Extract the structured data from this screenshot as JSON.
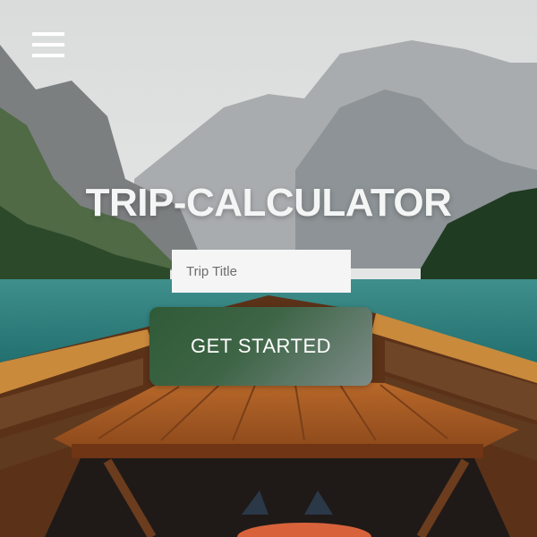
{
  "app": {
    "title": "TRIP-CALCULATOR"
  },
  "menu": {
    "icon": "hamburger-menu-icon"
  },
  "form": {
    "trip_title_placeholder": "Trip Title",
    "trip_title_value": "",
    "submit_label": "GET STARTED"
  },
  "background": {
    "scene": "mountain-lake-boat-photo"
  },
  "colors": {
    "button_gradient_start": "#2f5a37",
    "button_gradient_end": "#7d8c89",
    "title_text": "#f4f6f6",
    "input_background": "#f5f5f5"
  }
}
